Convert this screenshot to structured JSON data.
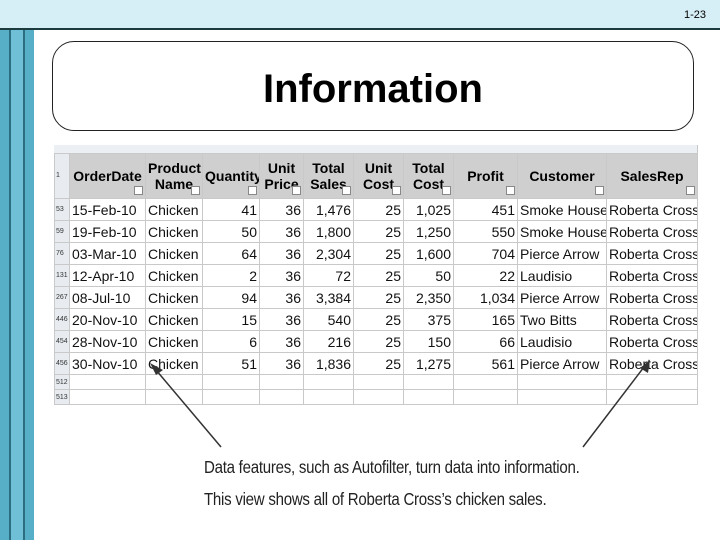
{
  "slide_number": "1-23",
  "title": "Information",
  "table": {
    "headers": [
      "OrderDate",
      "Product Name",
      "Quantity",
      "Unit Price",
      "Total Sales",
      "Unit Cost",
      "Total Cost",
      "Profit",
      "Customer",
      "SalesRep"
    ],
    "header_row_number": "1",
    "rows": [
      {
        "row_num": "53",
        "cells": [
          "15-Feb-10",
          "Chicken",
          "41",
          "36",
          "1,476",
          "25",
          "1,025",
          "451",
          "Smoke House",
          "Roberta Cross"
        ]
      },
      {
        "row_num": "59",
        "cells": [
          "19-Feb-10",
          "Chicken",
          "50",
          "36",
          "1,800",
          "25",
          "1,250",
          "550",
          "Smoke House",
          "Roberta Cross"
        ]
      },
      {
        "row_num": "76",
        "cells": [
          "03-Mar-10",
          "Chicken",
          "64",
          "36",
          "2,304",
          "25",
          "1,600",
          "704",
          "Pierce Arrow",
          "Roberta Cross"
        ]
      },
      {
        "row_num": "131",
        "cells": [
          "12-Apr-10",
          "Chicken",
          "2",
          "36",
          "72",
          "25",
          "50",
          "22",
          "Laudisio",
          "Roberta Cross"
        ]
      },
      {
        "row_num": "267",
        "cells": [
          "08-Jul-10",
          "Chicken",
          "94",
          "36",
          "3,384",
          "25",
          "2,350",
          "1,034",
          "Pierce Arrow",
          "Roberta Cross"
        ]
      },
      {
        "row_num": "446",
        "cells": [
          "20-Nov-10",
          "Chicken",
          "15",
          "36",
          "540",
          "25",
          "375",
          "165",
          "Two Bitts",
          "Roberta Cross"
        ]
      },
      {
        "row_num": "454",
        "cells": [
          "28-Nov-10",
          "Chicken",
          "6",
          "36",
          "216",
          "25",
          "150",
          "66",
          "Laudisio",
          "Roberta Cross"
        ]
      },
      {
        "row_num": "456",
        "cells": [
          "30-Nov-10",
          "Chicken",
          "51",
          "36",
          "1,836",
          "25",
          "1,275",
          "561",
          "Pierce Arrow",
          "Roberta Cross"
        ]
      }
    ],
    "empty_rows": [
      "512",
      "513"
    ]
  },
  "caption": {
    "line1": "Data features, such as Autofilter, turn data into information.",
    "line2": "This view shows all of Roberta Cross’s chicken sales."
  },
  "colors": {
    "header_bg": "#cfcfcf",
    "left_bar": "#57aec7",
    "top_bar": "#d6eef5"
  }
}
